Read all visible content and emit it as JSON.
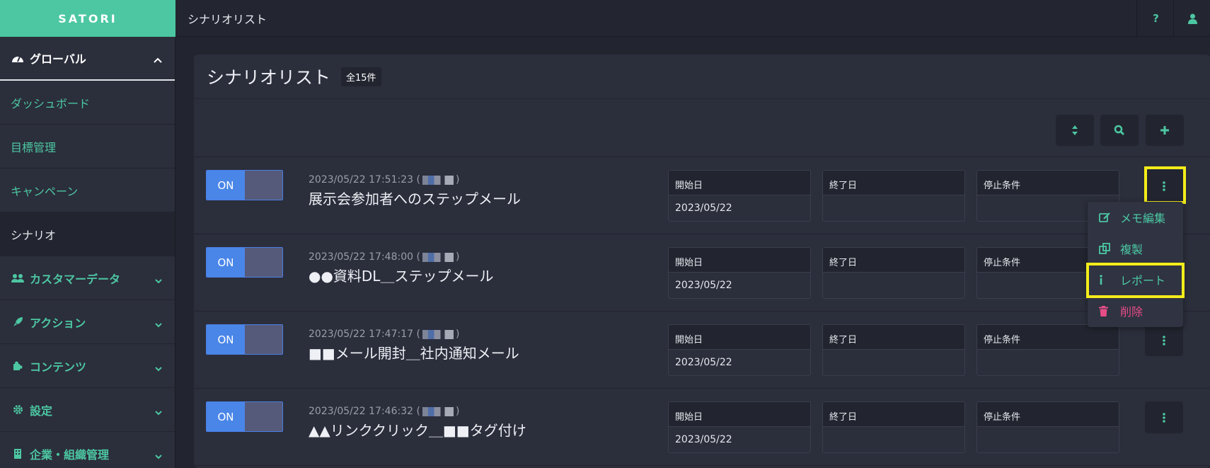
{
  "app": {
    "brand": "SATORI",
    "page_title": "シナリオリスト"
  },
  "topbar": {
    "help_glyph": "?"
  },
  "sidebar": {
    "header": {
      "label": "グローバル",
      "icon": "dashboard-gauge-icon"
    },
    "items": [
      {
        "label": "ダッシュボード"
      },
      {
        "label": "目標管理"
      },
      {
        "label": "キャンペーン"
      },
      {
        "label": "シナリオ"
      }
    ],
    "sections": [
      {
        "label": "カスタマーデータ",
        "icon": "users-icon"
      },
      {
        "label": "アクション",
        "icon": "rocket-icon"
      },
      {
        "label": "コンテンツ",
        "icon": "puzzle-icon"
      },
      {
        "label": "設定",
        "icon": "gear-icon"
      },
      {
        "label": "企業・組織管理",
        "icon": "building-icon"
      }
    ]
  },
  "panel": {
    "title": "シナリオリスト",
    "count": "全15件"
  },
  "field_labels": {
    "start": "開始日",
    "end": "終了日",
    "stop": "停止条件"
  },
  "scenarios": [
    {
      "toggle": "ON",
      "datetime": "2023/05/22 17:51:23 (",
      "close": ")",
      "title": "展示会参加者へのステップメール",
      "start": "2023/05/22",
      "end": "",
      "stop": ""
    },
    {
      "toggle": "ON",
      "datetime": "2023/05/22 17:48:00 (",
      "close": ")",
      "title": "●●資料DL＿ステップメール",
      "start": "2023/05/22",
      "end": "",
      "stop": ""
    },
    {
      "toggle": "ON",
      "datetime": "2023/05/22 17:47:17 (",
      "close": ")",
      "title": "■■メール開封＿社内通知メール",
      "start": "2023/05/22",
      "end": "",
      "stop": ""
    },
    {
      "toggle": "ON",
      "datetime": "2023/05/22 17:46:32 (",
      "close": ")",
      "title": "▲▲リンククリック＿■■タグ付け",
      "start": "2023/05/22",
      "end": "",
      "stop": ""
    }
  ],
  "context_menu": {
    "items": [
      {
        "label": "メモ編集",
        "icon": "edit-icon"
      },
      {
        "label": "複製",
        "icon": "copy-icon"
      },
      {
        "label": "レポート",
        "icon": "info-icon"
      },
      {
        "label": "削除",
        "icon": "trash-icon"
      }
    ]
  },
  "colors": {
    "accent": "#4cc7a2",
    "toggle_on": "#4a86e8",
    "highlight": "#f3ec1a",
    "danger": "#e64d87"
  }
}
